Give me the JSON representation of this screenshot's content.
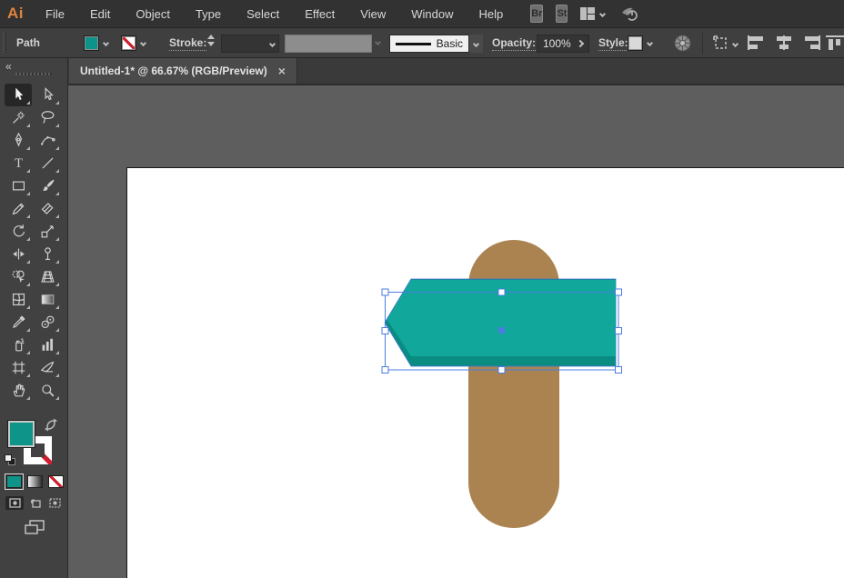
{
  "app": {
    "logo_text": "Ai"
  },
  "menu_bar": {
    "items": [
      "File",
      "Edit",
      "Object",
      "Type",
      "Select",
      "Effect",
      "View",
      "Window",
      "Help"
    ],
    "bridge_label": "Br",
    "stock_label": "St"
  },
  "control_bar": {
    "selection_type": "Path",
    "fill_swatch_color": "#0c948a",
    "stroke_swatch": "none",
    "stroke_label": "Stroke:",
    "stroke_weight_value": "",
    "brush_value": "Basic",
    "opacity_label": "Opacity:",
    "opacity_value": "100%",
    "style_label": "Style:"
  },
  "document_tab": {
    "title": "Untitled-1* @ 66.67% (RGB/Preview)",
    "close_glyph": "×"
  },
  "toolbar": {
    "collapse_glyph": "«",
    "tools": [
      {
        "id": "selection",
        "active": true
      },
      {
        "id": "direct-selection"
      },
      {
        "id": "magic-wand"
      },
      {
        "id": "lasso"
      },
      {
        "id": "pen"
      },
      {
        "id": "curvature"
      },
      {
        "id": "type"
      },
      {
        "id": "line-segment"
      },
      {
        "id": "rectangle"
      },
      {
        "id": "paintbrush"
      },
      {
        "id": "shaper-pencil"
      },
      {
        "id": "eraser"
      },
      {
        "id": "rotate"
      },
      {
        "id": "scale"
      },
      {
        "id": "width"
      },
      {
        "id": "puppet-warp"
      },
      {
        "id": "shape-builder"
      },
      {
        "id": "perspective-grid"
      },
      {
        "id": "mesh"
      },
      {
        "id": "gradient"
      },
      {
        "id": "eyedropper"
      },
      {
        "id": "blend"
      },
      {
        "id": "symbol-sprayer"
      },
      {
        "id": "column-graph"
      },
      {
        "id": "artboard-tool"
      },
      {
        "id": "slice"
      },
      {
        "id": "hand"
      },
      {
        "id": "zoom"
      }
    ],
    "fill_color": "#0e9488",
    "stroke_color": "none"
  },
  "canvas": {
    "artwork": {
      "post_color": "#aa8351",
      "sign_front_color": "#11a79a",
      "sign_shadow_color": "#0b8c81",
      "selection_color": "#4a7de0",
      "handle_fill": "#ffffff"
    }
  }
}
